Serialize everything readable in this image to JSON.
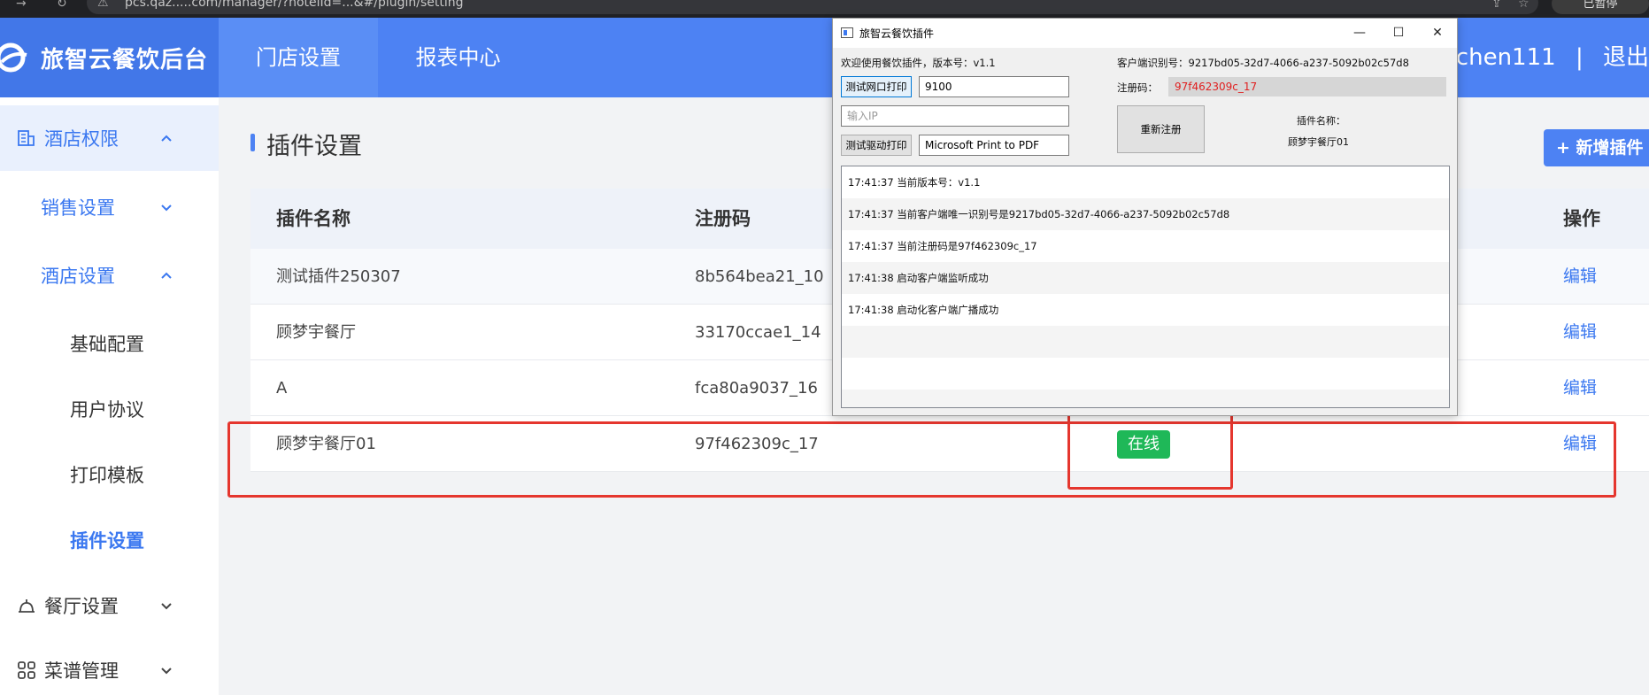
{
  "browser": {
    "url": "pcs.qaz.....com/manager/?hotelId=...&#/plugin/setting",
    "profile_label": "已暂停"
  },
  "header": {
    "app_title": "旅智云餐饮后台",
    "nav": [
      {
        "label": "门店设置",
        "active": true
      },
      {
        "label": "报表中心",
        "active": false
      }
    ],
    "user": "liuchen111",
    "separator": "|",
    "logout": "退出"
  },
  "sidebar": {
    "items": [
      {
        "label": "酒店权限",
        "icon": "building-icon",
        "level": 0,
        "expanded": true
      },
      {
        "label": "销售设置",
        "level": 1,
        "expanded": false
      },
      {
        "label": "酒店设置",
        "level": 1,
        "expanded": true
      },
      {
        "label": "基础配置",
        "level": 2
      },
      {
        "label": "用户协议",
        "level": 2
      },
      {
        "label": "打印模板",
        "level": 2
      },
      {
        "label": "插件设置",
        "level": 2,
        "active": true
      },
      {
        "label": "餐厅设置",
        "icon": "bell-icon",
        "level": 0,
        "expanded": false
      },
      {
        "label": "菜谱管理",
        "icon": "grid-icon",
        "level": 0,
        "expanded": false
      }
    ]
  },
  "main": {
    "title": "插件设置",
    "add_button": "+ 新增插件",
    "columns": [
      "插件名称",
      "注册码",
      "操作"
    ],
    "rows": [
      {
        "name": "测试插件250307",
        "code": "8b564bea21_10",
        "action": "编辑"
      },
      {
        "name": "顾梦宇餐厅",
        "code": "33170ccae1_14",
        "action": "编辑"
      },
      {
        "name": "A",
        "code": "fca80a9037_16",
        "action": "编辑"
      },
      {
        "name": "顾梦宇餐厅01",
        "code": "97f462309c_17",
        "status": "在线",
        "action": "编辑"
      }
    ]
  },
  "dialog": {
    "title": "旅智云餐饮插件",
    "welcome": "欢迎使用餐饮插件，版本号：v1.1",
    "client_id": "客户端识别号：9217bd05-32d7-4066-a237-5092b02c57d8",
    "test_net_print": "测试网口打印",
    "port": "9100",
    "reg_code_label": "注册码：",
    "reg_code": "97f462309c_17",
    "ip_placeholder": "输入IP",
    "re_register": "重新注册",
    "plugin_name_label": "插件名称：",
    "plugin_name": "顾梦宇餐厅01",
    "test_driver_print": "测试驱动打印",
    "printer": "Microsoft Print to PDF",
    "log": [
      "17:41:37 当前版本号：v1.1",
      "17:41:37 当前客户端唯一识别号是9217bd05-32d7-4066-a237-5092b02c57d8",
      "17:41:37 当前注册码是97f462309c_17",
      "17:41:38 启动客户端监听成功",
      "17:41:38 启动化客户端广播成功",
      "",
      ""
    ]
  },
  "colors": {
    "primary": "#4d82f3",
    "online": "#1fb858",
    "highlight_box": "#e5362e"
  }
}
